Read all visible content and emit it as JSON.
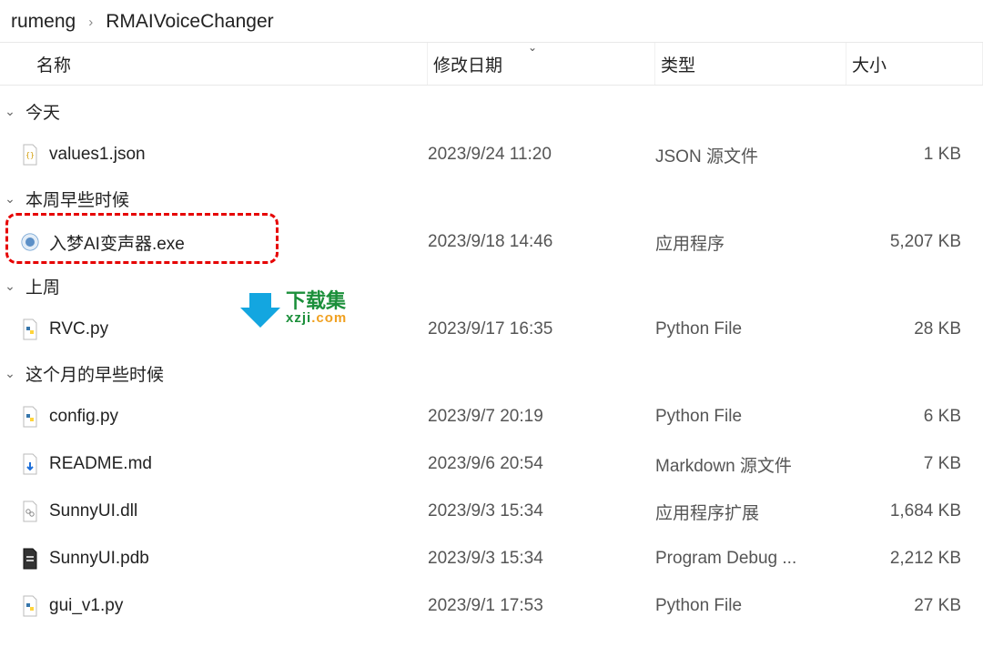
{
  "breadcrumb": {
    "a": "rumeng",
    "b": "RMAIVoiceChanger"
  },
  "headers": {
    "name": "名称",
    "date": "修改日期",
    "type": "类型",
    "size": "大小"
  },
  "groups": {
    "g0": "今天",
    "g1": "本周早些时候",
    "g2": "上周",
    "g3": "这个月的早些时候"
  },
  "files": {
    "f0": {
      "name": "values1.json",
      "date": "2023/9/24 11:20",
      "type": "JSON 源文件",
      "size": "1 KB"
    },
    "f1": {
      "name": "入梦AI变声器.exe",
      "date": "2023/9/18 14:46",
      "type": "应用程序",
      "size": "5,207 KB"
    },
    "f2": {
      "name": "RVC.py",
      "date": "2023/9/17 16:35",
      "type": "Python File",
      "size": "28 KB"
    },
    "f3": {
      "name": "config.py",
      "date": "2023/9/7 20:19",
      "type": "Python File",
      "size": "6 KB"
    },
    "f4": {
      "name": "README.md",
      "date": "2023/9/6 20:54",
      "type": "Markdown 源文件",
      "size": "7 KB"
    },
    "f5": {
      "name": "SunnyUI.dll",
      "date": "2023/9/3 15:34",
      "type": "应用程序扩展",
      "size": "1,684 KB"
    },
    "f6": {
      "name": "SunnyUI.pdb",
      "date": "2023/9/3 15:34",
      "type": "Program Debug ...",
      "size": "2,212 KB"
    },
    "f7": {
      "name": "gui_v1.py",
      "date": "2023/9/1 17:53",
      "type": "Python File",
      "size": "27 KB"
    }
  },
  "watermark": {
    "line1": "下载集",
    "line2a": "xzji",
    "line2b": ".com"
  }
}
